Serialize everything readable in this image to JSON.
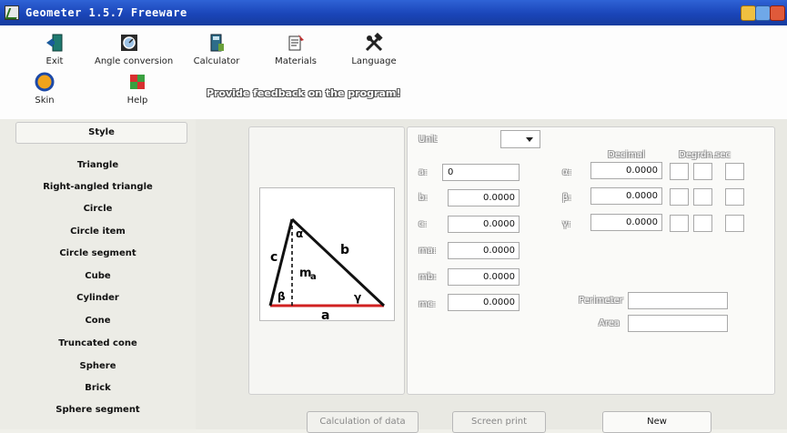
{
  "window": {
    "title": "Geometer 1.5.7 Freeware"
  },
  "toolbar": {
    "exit": "Exit",
    "angle_conversion": "Angle conversion",
    "calculator": "Calculator",
    "materials": "Materials",
    "language": "Language",
    "skin": "Skin",
    "help": "Help",
    "feedback": "Provide feedback on the program!"
  },
  "sidebar": {
    "header": "Style",
    "items": [
      "Triangle",
      "Right-angled triangle",
      "Circle",
      "Circle item",
      "Circle segment",
      "Cube",
      "Cylinder",
      "Cone",
      "Truncated cone",
      "Sphere",
      "Brick",
      "Sphere segment"
    ]
  },
  "diagram": {
    "labels": {
      "c": "c",
      "b": "b",
      "a": "a",
      "alpha": "α",
      "beta": "β",
      "gamma": "γ",
      "ma": "m",
      "ma_sub": "a"
    }
  },
  "form": {
    "unit_label": "Unit",
    "unit_value": "",
    "decimal_header": "Decimal",
    "degrees_header": "Degrdn.sec",
    "sides": [
      {
        "label": "a:",
        "value": "0"
      },
      {
        "label": "b:",
        "value": "0.0000"
      },
      {
        "label": "c:",
        "value": "0.0000"
      },
      {
        "label": "ma:",
        "value": "0.0000"
      },
      {
        "label": "mb:",
        "value": "0.0000"
      },
      {
        "label": "mc:",
        "value": "0.0000"
      }
    ],
    "angles": [
      {
        "label": "α:",
        "value": "0.0000"
      },
      {
        "label": "β:",
        "value": "0.0000"
      },
      {
        "label": "γ:",
        "value": "0.0000"
      }
    ],
    "perimeter_label": "Perimeter",
    "perimeter_value": "",
    "area_label": "Area",
    "area_value": ""
  },
  "buttons": {
    "calculation": "Calculation of data",
    "screen_print": "Screen print",
    "new": "New"
  }
}
